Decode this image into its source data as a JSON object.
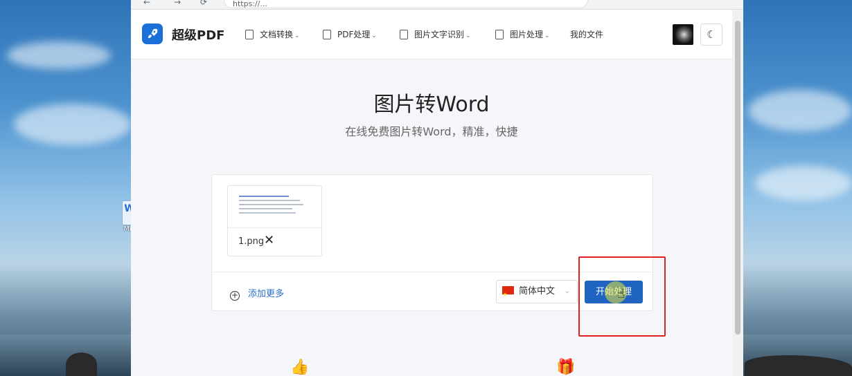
{
  "desktop": {
    "icon_label": "Mic"
  },
  "browser": {
    "url_text": "https://...",
    "nav_back": "←",
    "nav_forward": "→",
    "nav_reload": "⟳"
  },
  "header": {
    "brand": "超级PDF",
    "menu": [
      {
        "label": "文档转换"
      },
      {
        "label": "PDF处理"
      },
      {
        "label": "图片文字识别"
      },
      {
        "label": "图片处理"
      },
      {
        "label": "我的文件"
      }
    ],
    "theme_icon": "☾"
  },
  "main": {
    "title": "图片转Word",
    "subtitle": "在线免费图片转Word，精准，快捷",
    "file": {
      "name": "1.png",
      "remove": "✕"
    },
    "add_more": "添加更多",
    "language": "简体中文",
    "start_button": "开始处理"
  },
  "icons": {
    "logo": "rocket-icon",
    "theme": "moon-icon",
    "add": "plus-circle-icon",
    "remove": "close-icon"
  },
  "colors": {
    "primary": "#1f64c0",
    "highlight_box": "#e02020",
    "page_bg": "#f4f6f9"
  }
}
